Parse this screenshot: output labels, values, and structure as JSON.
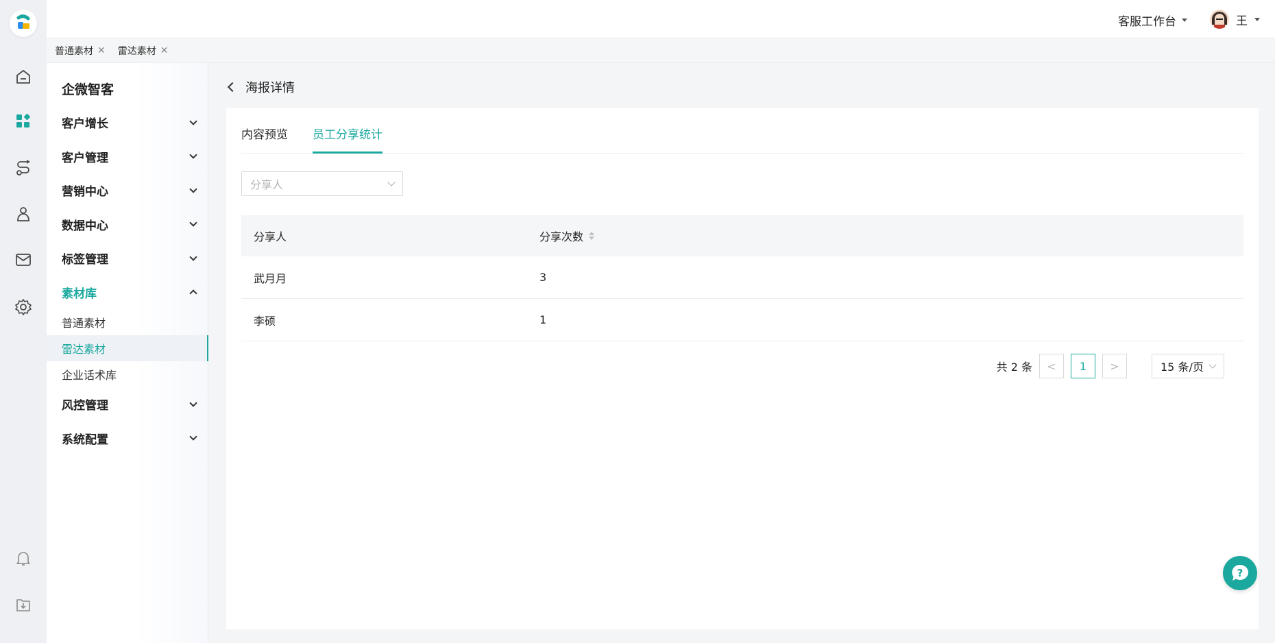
{
  "colors": {
    "accent": "#1ba89e",
    "text": "#262626",
    "muted": "#b5b5b5"
  },
  "rail": {
    "icons": [
      "app-logo-icon",
      "home-icon",
      "apps-icon",
      "route-icon",
      "customer-icon",
      "mail-icon",
      "settings-icon",
      "bell-icon",
      "download-icon"
    ]
  },
  "header": {
    "workspace": "客服工作台",
    "user_name": "王"
  },
  "page_tabs": [
    {
      "label": "普通素材"
    },
    {
      "label": "雷达素材"
    }
  ],
  "page_tab_close": "✕",
  "sidebar": {
    "brand": "企微智客",
    "menu": [
      {
        "label": "客户增长"
      },
      {
        "label": "客户管理"
      },
      {
        "label": "营销中心"
      },
      {
        "label": "数据中心"
      },
      {
        "label": "标签管理"
      },
      {
        "label": "素材库"
      },
      {
        "label": "风控管理"
      },
      {
        "label": "系统配置"
      }
    ],
    "submenu": [
      {
        "label": "普通素材"
      },
      {
        "label": "雷达素材"
      },
      {
        "label": "企业话术库"
      }
    ]
  },
  "main": {
    "title": "海报详情",
    "tabs": [
      {
        "label": "内容预览"
      },
      {
        "label": "员工分享统计"
      }
    ],
    "filter_placeholder": "分享人",
    "table": {
      "columns": [
        "分享人",
        "分享次数"
      ],
      "rows": [
        {
          "name": "武月月",
          "count": "3"
        },
        {
          "name": "李硕",
          "count": "1"
        }
      ]
    },
    "pagination": {
      "total": "共 2 条",
      "current": "1",
      "page_size": "15 条/页",
      "prev": "<",
      "next": ">"
    }
  },
  "help": {
    "icon": "help-chat-icon",
    "glyph": "?"
  }
}
